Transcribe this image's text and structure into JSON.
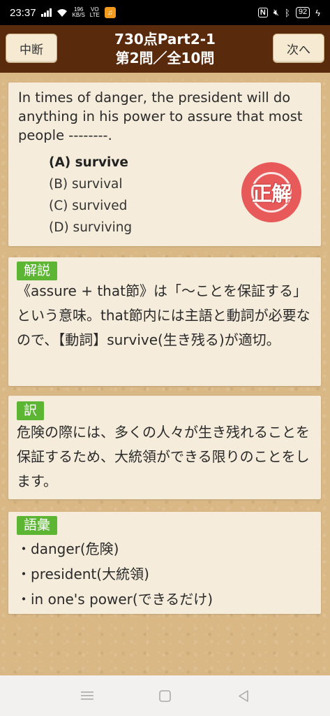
{
  "status": {
    "time": "23:37",
    "net_speed_top": "196",
    "net_speed_bottom": "KB/S",
    "network_label_top": "VO",
    "network_label_bottom": "LTE",
    "battery": "92",
    "icons": [
      "signal-icon",
      "wifi-icon",
      "app-notification-icon",
      "nfc-icon",
      "mute-icon",
      "bluetooth-icon",
      "battery-icon",
      "charging-icon"
    ]
  },
  "header": {
    "quit_label": "中断",
    "title_line1": "730点Part2-1",
    "title_line2": "第2問／全10問",
    "next_label": "次へ"
  },
  "question": {
    "text": "In times of danger, the president will do anything in his power to assure that most people --------.",
    "choices": [
      {
        "label": "(A) survive",
        "correct": true
      },
      {
        "label": "(B) survival",
        "correct": false
      },
      {
        "label": "(C) survived",
        "correct": false
      },
      {
        "label": "(D) surviving",
        "correct": false
      }
    ],
    "result_stamp": "正解",
    "stamp_color": "#e85a5a"
  },
  "explanation": {
    "tag": "解説",
    "text": "《assure + that節》は「～ことを保証する」という意味。that節内には主語と動詞が必要なので、【動詞】survive(生き残る)が適切。"
  },
  "translation": {
    "tag": "訳",
    "text": "危険の際には、多くの人々が生き残れることを保証するため、大統領ができる限りのことをします。"
  },
  "vocabulary": {
    "tag": "語彙",
    "items": [
      "danger(危険)",
      "president(大統領)",
      "in one's power(できるだけ)"
    ]
  },
  "colors": {
    "header_bg": "#5a2a0d",
    "tag_green": "#5db534",
    "card_bg": "#f5ecdb",
    "background": "#d9b886"
  },
  "nav": {
    "icons": [
      "menu-icon",
      "home-icon",
      "back-icon"
    ]
  }
}
